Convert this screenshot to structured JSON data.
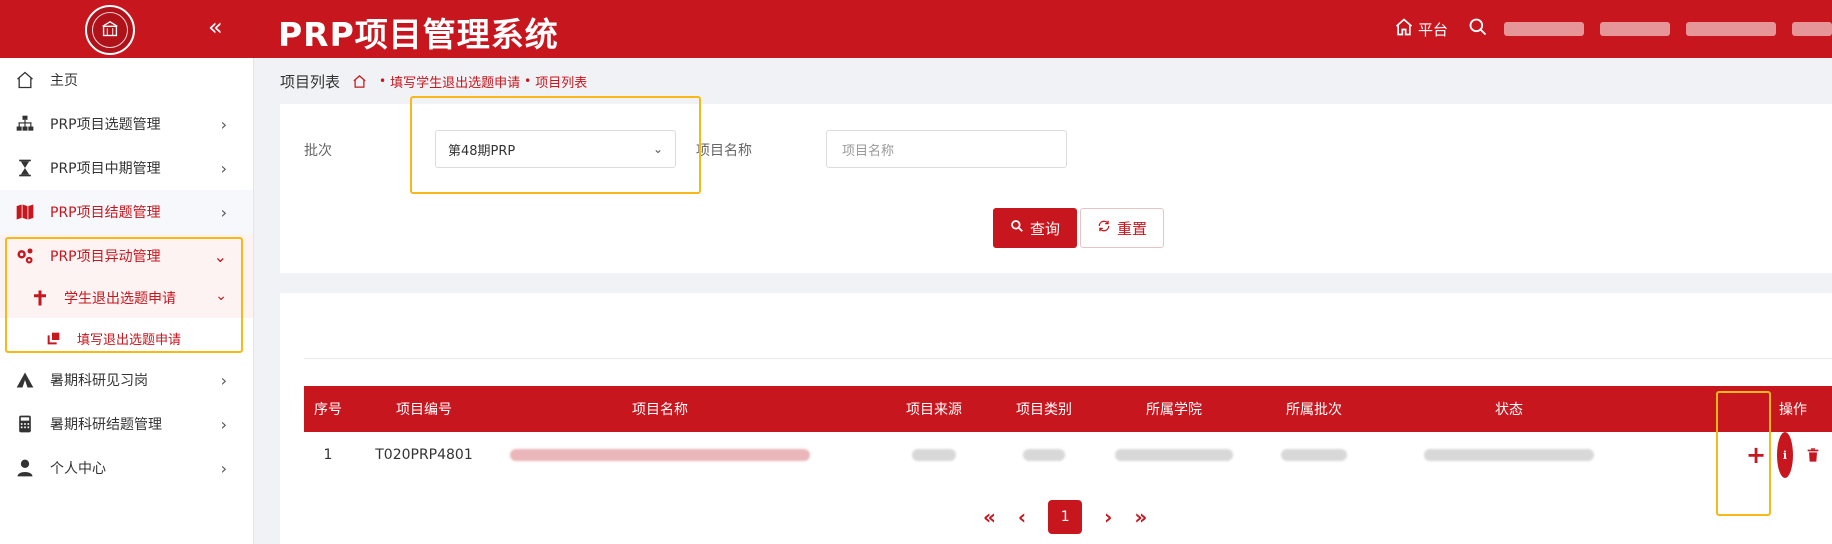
{
  "header": {
    "title": "PRP项目管理系统",
    "collapse_icon": "«",
    "platform_label": "平台"
  },
  "sidebar": {
    "items": [
      {
        "label": "主页",
        "icon": "home-icon"
      },
      {
        "label": "PRP项目选题管理",
        "icon": "sitemap-icon"
      },
      {
        "label": "PRP项目中期管理",
        "icon": "hourglass-icon"
      },
      {
        "label": "PRP项目结题管理",
        "icon": "map-icon"
      },
      {
        "label": "PRP项目异动管理",
        "icon": "gears-icon"
      },
      {
        "label": "暑期科研见习岗",
        "icon": "tent-icon"
      },
      {
        "label": "暑期科研结题管理",
        "icon": "calculator-icon"
      },
      {
        "label": "个人中心",
        "icon": "user-icon"
      }
    ],
    "sub_item": "学生退出选题申请",
    "sub_sub_item": "填写退出选题申请"
  },
  "breadcrumb": {
    "title": "项目列表",
    "crumb1": "填写学生退出选题申请",
    "crumb2": "项目列表"
  },
  "search": {
    "batch_label": "批次",
    "batch_value": "第48期PRP",
    "name_label": "项目名称",
    "name_placeholder": "项目名称",
    "query_button": "查询",
    "reset_button": "重置"
  },
  "table": {
    "headers": [
      "序号",
      "项目编号",
      "项目名称",
      "项目来源",
      "项目类别",
      "所属学院",
      "所属批次",
      "状态",
      "操作"
    ],
    "rows": [
      {
        "index": "1",
        "code": "T020PRP4801"
      }
    ]
  },
  "pagination": {
    "current_page": "1"
  },
  "colors": {
    "brand": "#c8161e",
    "annotation": "#f7b818"
  }
}
